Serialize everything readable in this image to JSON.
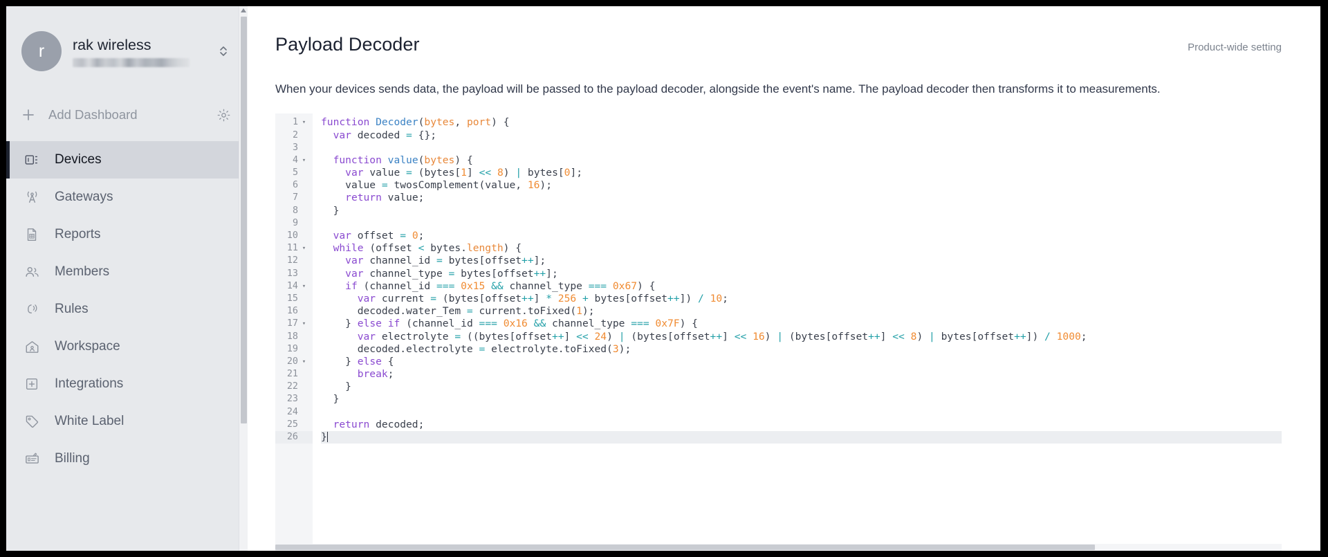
{
  "sidebar": {
    "workspace": {
      "avatar_initial": "r",
      "name": "rak wireless",
      "subtitle_redacted": true,
      "switch_icon": "chevron-up-down-icon"
    },
    "add_dashboard": {
      "label": "Add Dashboard",
      "plus_icon": "plus-icon",
      "gear_icon": "gear-icon"
    },
    "items": [
      {
        "label": "Devices",
        "icon": "devices-icon",
        "active": true
      },
      {
        "label": "Gateways",
        "icon": "antenna-icon",
        "active": false
      },
      {
        "label": "Reports",
        "icon": "report-file-icon",
        "active": false
      },
      {
        "label": "Members",
        "icon": "users-icon",
        "active": false
      },
      {
        "label": "Rules",
        "icon": "rules-bell-icon",
        "active": false
      },
      {
        "label": "Workspace",
        "icon": "home-user-icon",
        "active": false
      },
      {
        "label": "Integrations",
        "icon": "plus-square-icon",
        "active": false
      },
      {
        "label": "White Label",
        "icon": "tag-icon",
        "active": false
      },
      {
        "label": "Billing",
        "icon": "invoice-icon",
        "active": false
      }
    ]
  },
  "main": {
    "title": "Payload Decoder",
    "setting_scope": "Product-wide setting",
    "description": "When your devices sends data, the payload will be passed to the payload decoder, alongside the event's name. The payload decoder then transforms it to measurements."
  },
  "editor": {
    "current_line": 26,
    "colors": {
      "keyword": "#8a4ad0",
      "function": "#3b82c4",
      "parameter": "#e8883a",
      "number": "#f08b32",
      "operator": "#23a0a8",
      "text": "#3b414d",
      "gutter_bg": "#f4f5f7"
    },
    "lines": [
      {
        "n": 1,
        "fold": true,
        "text": "function Decoder(bytes, port) {"
      },
      {
        "n": 2,
        "fold": false,
        "text": "  var decoded = {};"
      },
      {
        "n": 3,
        "fold": false,
        "text": ""
      },
      {
        "n": 4,
        "fold": true,
        "text": "  function value(bytes) {"
      },
      {
        "n": 5,
        "fold": false,
        "text": "    var value = (bytes[1] << 8) | bytes[0];"
      },
      {
        "n": 6,
        "fold": false,
        "text": "    value = twosComplement(value, 16);"
      },
      {
        "n": 7,
        "fold": false,
        "text": "    return value;"
      },
      {
        "n": 8,
        "fold": false,
        "text": "  }"
      },
      {
        "n": 9,
        "fold": false,
        "text": ""
      },
      {
        "n": 10,
        "fold": false,
        "text": "  var offset = 0;"
      },
      {
        "n": 11,
        "fold": true,
        "text": "  while (offset < bytes.length) {"
      },
      {
        "n": 12,
        "fold": false,
        "text": "    var channel_id = bytes[offset++];"
      },
      {
        "n": 13,
        "fold": false,
        "text": "    var channel_type = bytes[offset++];"
      },
      {
        "n": 14,
        "fold": true,
        "text": "    if (channel_id === 0x15 && channel_type === 0x67) {"
      },
      {
        "n": 15,
        "fold": false,
        "text": "      var current = (bytes[offset++] * 256 + bytes[offset++]) / 10;"
      },
      {
        "n": 16,
        "fold": false,
        "text": "      decoded.water_Tem = current.toFixed(1);"
      },
      {
        "n": 17,
        "fold": true,
        "text": "    } else if (channel_id === 0x16 && channel_type === 0x7F) {"
      },
      {
        "n": 18,
        "fold": false,
        "text": "      var electrolyte = ((bytes[offset++] << 24) | (bytes[offset++] << 16) | (bytes[offset++] << 8) | bytes[offset++]) / 1000;"
      },
      {
        "n": 19,
        "fold": false,
        "text": "      decoded.electrolyte = electrolyte.toFixed(3);"
      },
      {
        "n": 20,
        "fold": true,
        "text": "    } else {"
      },
      {
        "n": 21,
        "fold": false,
        "text": "      break;"
      },
      {
        "n": 22,
        "fold": false,
        "text": "    }"
      },
      {
        "n": 23,
        "fold": false,
        "text": "  }"
      },
      {
        "n": 24,
        "fold": false,
        "text": ""
      },
      {
        "n": 25,
        "fold": false,
        "text": "  return decoded;"
      },
      {
        "n": 26,
        "fold": false,
        "text": "}"
      }
    ]
  }
}
